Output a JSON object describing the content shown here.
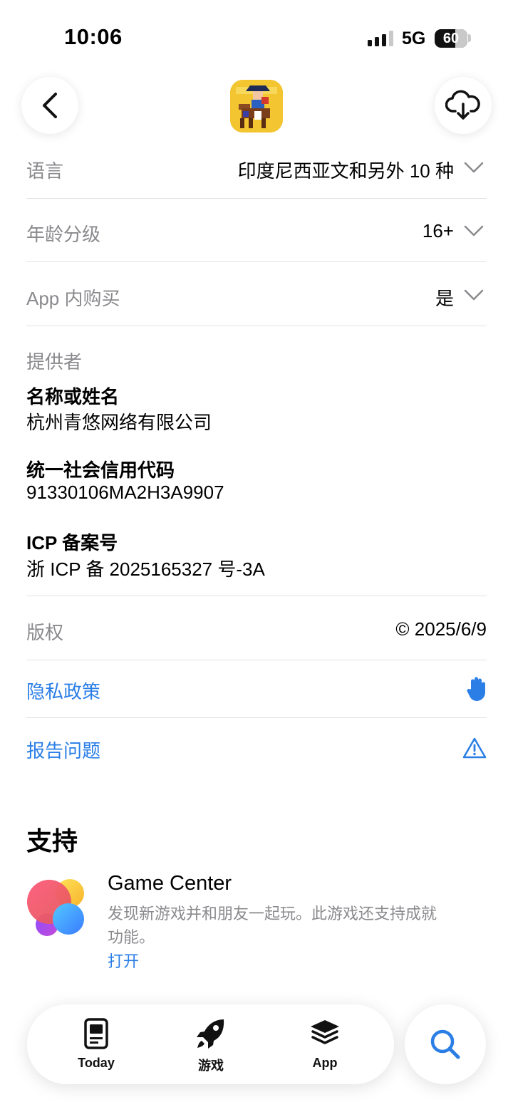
{
  "status_bar": {
    "time": "10:06",
    "network": "5G",
    "battery": "60"
  },
  "info": {
    "language": {
      "label": "语言",
      "value": "印度尼西亚文和另外 10 种"
    },
    "age_rating": {
      "label": "年龄分级",
      "value": "16+"
    },
    "in_app_purchase": {
      "label": "App 内购买",
      "value": "是"
    },
    "provider": {
      "label": "提供者",
      "name_title": "名称或姓名",
      "name_value": "杭州青悠网络有限公司",
      "credit_title": "统一社会信用代码",
      "credit_value": "91330106MA2H3A9907",
      "icp_title": "ICP 备案号",
      "icp_value": "浙 ICP 备 2025165327 号-3A"
    },
    "copyright": {
      "label": "版权",
      "value": "© 2025/6/9"
    },
    "privacy_link": "隐私政策",
    "report_link": "报告问题"
  },
  "support": {
    "title": "支持",
    "game_center": {
      "title": "Game Center",
      "description": "发现新游戏并和朋友一起玩。此游戏还支持成就功能。",
      "open_label": "打开"
    }
  },
  "tabbar": {
    "today": "Today",
    "games": "游戏",
    "apps": "App"
  },
  "colors": {
    "link": "#2a7ee6",
    "label_gray": "#8a8a8e",
    "divider": "#e2e2e6"
  }
}
